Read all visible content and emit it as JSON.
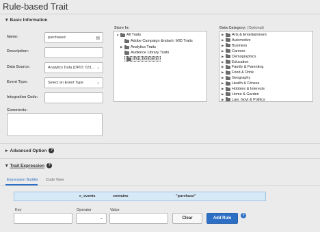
{
  "page": {
    "title": "Rule-based Trait"
  },
  "basic": {
    "title": "Basic Information",
    "fields": {
      "name": {
        "label": "Name:",
        "value": "purchased"
      },
      "description": {
        "label": "Description:",
        "value": ""
      },
      "data_source": {
        "label": "Data Source:",
        "value": "Analytics Data (DPID: 631..."
      },
      "event_type": {
        "label": "Event Type:",
        "value": "Select an Event Type"
      },
      "integration_code": {
        "label": "Integration Code:",
        "value": ""
      },
      "comments": {
        "label": "Comments:",
        "value": ""
      }
    }
  },
  "store_in": {
    "label": "Store In:",
    "tree": [
      {
        "label": "All Traits",
        "expanded": true
      },
      {
        "label": "Adobe Campaign &ndash; MID Traits"
      },
      {
        "label": "Analytics Traits"
      },
      {
        "label": "Audience Library Traits"
      },
      {
        "label": "dmp_bootcamp",
        "selected": true
      }
    ]
  },
  "data_category": {
    "label": "Data Category:",
    "optional": "(Optional)",
    "items": [
      "Arts & Entertainment",
      "Automotive",
      "Business",
      "Careers",
      "Demographics",
      "Education",
      "Family & Parenting",
      "Food & Drink",
      "Geography",
      "Health & Fitness",
      "Hobbies & Interests",
      "Home & Garden",
      "Law, Govt & Politics"
    ]
  },
  "advanced": {
    "title": "Advanced Option"
  },
  "trait_expression": {
    "title": "Trait Expression",
    "tabs": [
      "Expression Builder",
      "Code View"
    ],
    "active_tab": 0,
    "expression": {
      "key": "c_events",
      "operator": "contains",
      "value": "\"purchase\""
    },
    "rule": {
      "key_label": "Key",
      "operator_label": "Operator",
      "value_label": "Value",
      "clear_label": "Clear",
      "add_label": "Add Rule"
    }
  },
  "colors": {
    "accent": "#2d6fc4",
    "expression_bg": "#d6e9f7"
  }
}
